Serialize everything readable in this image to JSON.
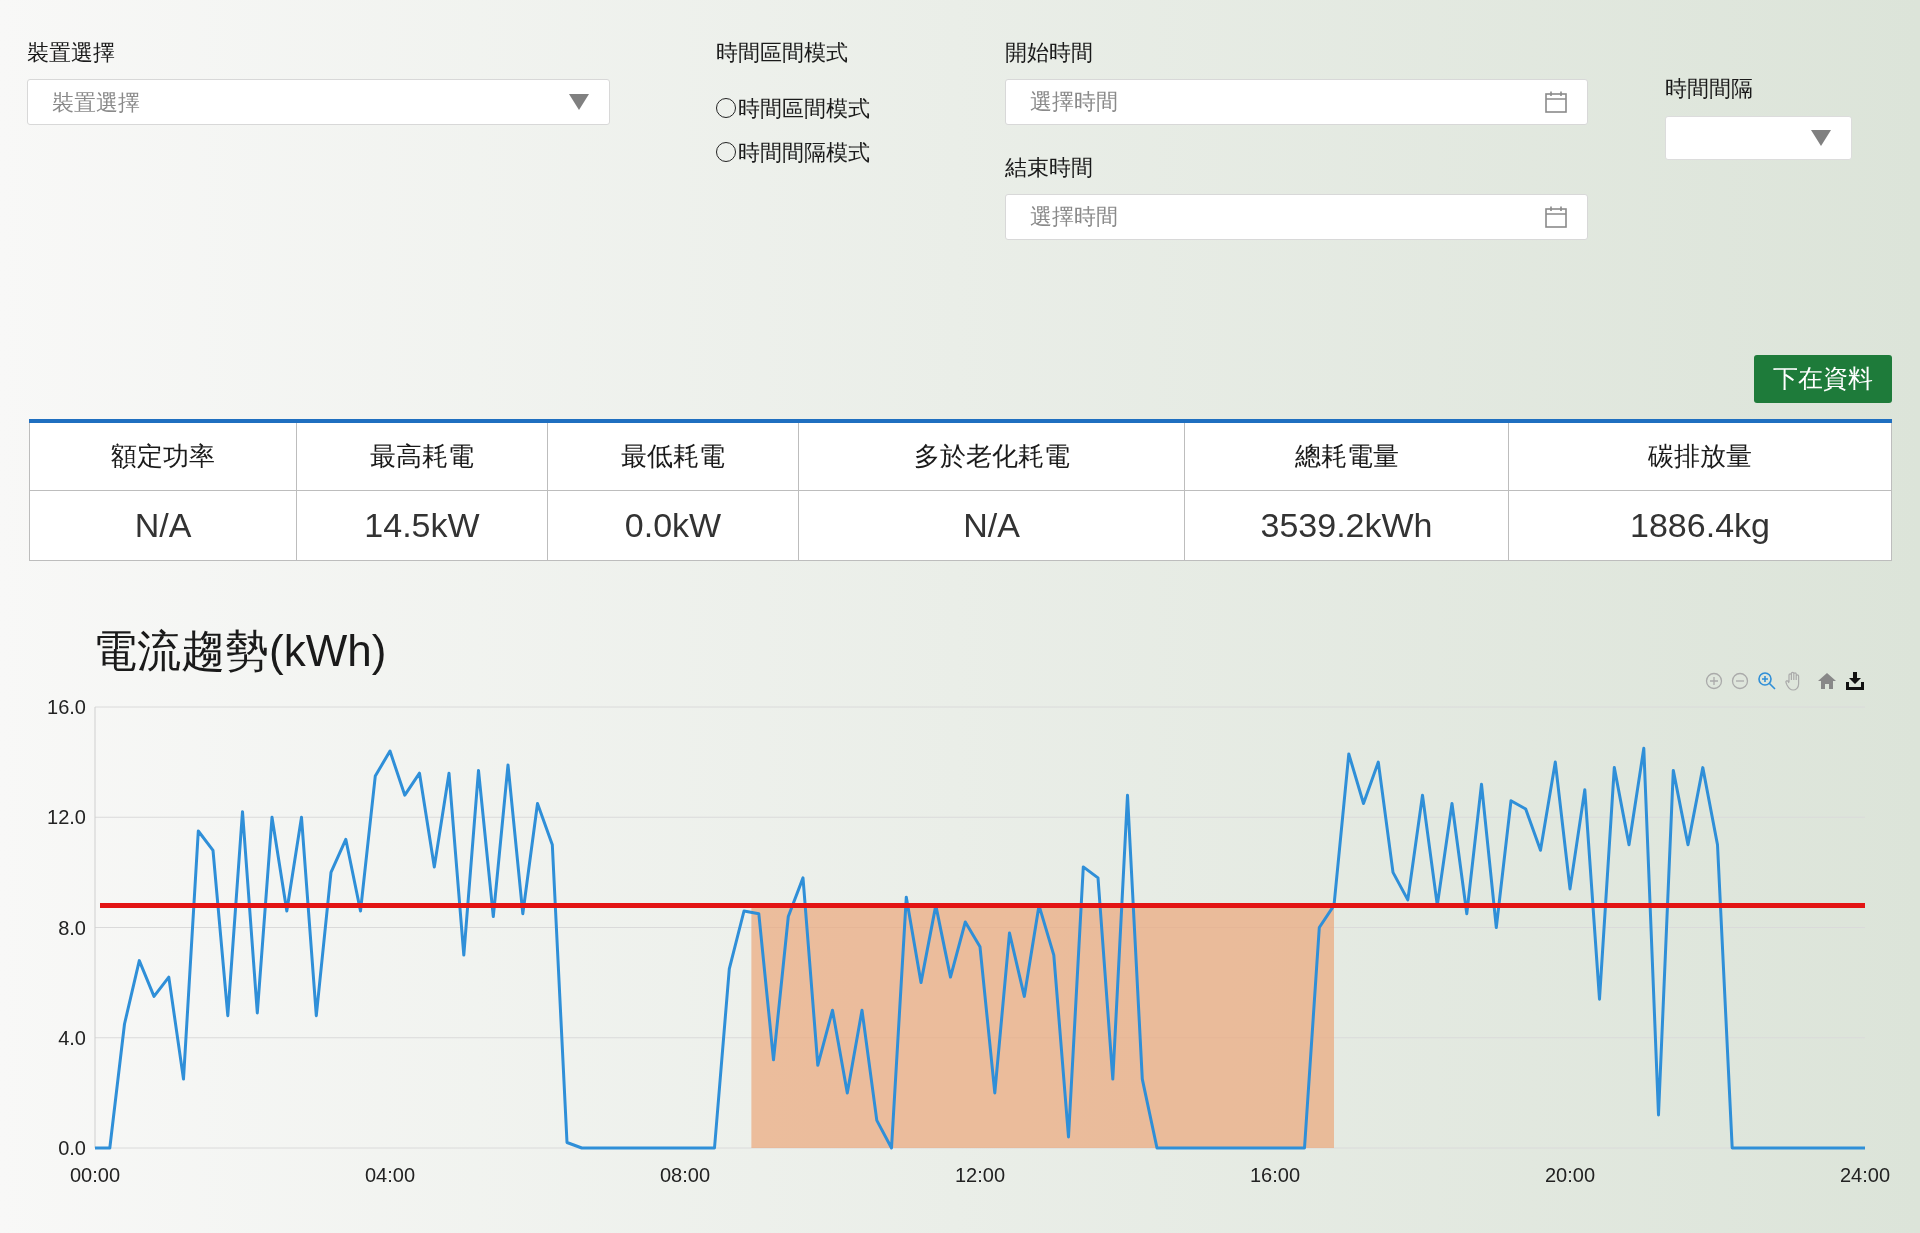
{
  "device": {
    "label": "裝置選擇",
    "placeholder": "裝置選擇"
  },
  "time_mode": {
    "label": "時間區間模式",
    "options": [
      {
        "label": "時間區間模式",
        "selected": false
      },
      {
        "label": "時間間隔模式",
        "selected": false
      }
    ]
  },
  "start_time": {
    "label": "開始時間",
    "placeholder": "選擇時間"
  },
  "end_time": {
    "label": "結束時間",
    "placeholder": "選擇時間"
  },
  "interval": {
    "label": "時間間隔"
  },
  "download_button": "下在資料",
  "table": {
    "columns": [
      "額定功率",
      "最高耗電",
      "最低耗電",
      "多於老化耗電",
      "總耗電量",
      "碳排放量"
    ],
    "rows": [
      [
        "N/A",
        "14.5kW",
        "0.0kW",
        "N/A",
        "3539.2kWh",
        "1886.4kg"
      ]
    ]
  },
  "chart": {
    "title": "電流趨勢(kWh)",
    "chart_data": {
      "type": "line",
      "x": [
        0,
        0.2,
        0.4,
        0.6,
        0.8,
        1,
        1.2,
        1.4,
        1.6,
        1.8,
        2,
        2.2,
        2.4,
        2.6,
        2.8,
        3,
        3.2,
        3.4,
        3.6,
        3.8,
        4,
        4.2,
        4.4,
        4.6,
        4.8,
        5,
        5.2,
        5.4,
        5.6,
        5.8,
        6,
        6.2,
        6.4,
        6.6,
        6.8,
        7,
        7.2,
        7.4,
        7.6,
        7.8,
        8,
        8.2,
        8.4,
        8.6,
        8.8,
        9,
        9.2,
        9.4,
        9.6,
        9.8,
        10,
        10.2,
        10.4,
        10.6,
        10.8,
        11,
        11.2,
        11.4,
        11.6,
        11.8,
        12,
        12.2,
        12.4,
        12.6,
        12.8,
        13,
        13.2,
        13.4,
        13.6,
        13.8,
        14,
        14.2,
        14.4,
        14.6,
        14.8,
        15,
        15.2,
        15.4,
        15.6,
        15.8,
        16,
        16.2,
        16.4,
        16.6,
        16.8,
        17,
        17.2,
        17.4,
        17.6,
        17.8,
        18,
        18.2,
        18.4,
        18.6,
        18.8,
        19,
        19.2,
        19.4,
        19.6,
        19.8,
        20,
        20.2,
        20.4,
        20.6,
        20.8,
        21,
        21.2,
        21.4,
        21.6,
        21.8,
        22,
        22.2,
        22.4,
        22.6,
        22.8,
        23,
        23.2,
        23.4,
        23.6,
        23.8,
        24
      ],
      "series": [
        {
          "color": "#2f8fd8",
          "values": [
            0,
            0,
            4.5,
            6.8,
            5.5,
            6.2,
            2.5,
            11.5,
            10.8,
            4.8,
            12.2,
            4.9,
            12,
            8.6,
            12,
            4.8,
            10,
            11.2,
            8.6,
            13.5,
            14.4,
            12.8,
            13.6,
            10.2,
            13.6,
            7,
            13.7,
            8.4,
            13.9,
            8.5,
            12.5,
            11,
            0.2,
            0,
            0,
            0,
            0,
            0,
            0,
            0,
            0,
            0,
            0,
            6.5,
            8.6,
            8.5,
            3.2,
            8.4,
            9.8,
            3,
            5,
            2,
            5,
            1,
            0,
            9.1,
            6,
            8.8,
            6.2,
            8.2,
            7.3,
            2,
            7.8,
            5.5,
            8.8,
            7,
            0.4,
            10.2,
            9.8,
            2.5,
            12.8,
            2.5,
            0,
            0,
            0,
            0,
            0,
            0,
            0,
            0,
            0,
            0,
            0,
            8,
            8.8,
            14.3,
            12.5,
            14,
            10,
            9,
            12.8,
            8.8,
            12.5,
            8.5,
            13.2,
            8,
            12.6,
            12.3,
            10.8,
            14,
            9.4,
            13,
            5.4,
            13.8,
            11,
            14.5,
            1.2,
            13.7,
            11,
            13.8,
            11,
            0,
            0,
            0,
            0,
            0,
            0,
            0,
            0,
            0,
            0
          ]
        }
      ],
      "xlim": [
        0,
        24
      ],
      "ylim": [
        0,
        16
      ],
      "xticks": [
        {
          "value": 0,
          "label": "00:00"
        },
        {
          "value": 4,
          "label": "04:00"
        },
        {
          "value": 8,
          "label": "08:00"
        },
        {
          "value": 12,
          "label": "12:00"
        },
        {
          "value": 16,
          "label": "16:00"
        },
        {
          "value": 20,
          "label": "20:00"
        },
        {
          "value": 24,
          "label": "24:00"
        }
      ],
      "yticks": [
        {
          "value": 0,
          "label": "0.0"
        },
        {
          "value": 4,
          "label": "4.0"
        },
        {
          "value": 8,
          "label": "8.0"
        },
        {
          "value": 12,
          "label": "12.0"
        },
        {
          "value": 16,
          "label": "16.0"
        }
      ],
      "grid": true,
      "ref_lines": [
        {
          "axis": "y",
          "value": 8.8,
          "color": "#e31414"
        }
      ],
      "bands": [
        {
          "axis": "x",
          "from": 8.9,
          "to": 16.8,
          "color": "#eba67a"
        }
      ]
    }
  }
}
